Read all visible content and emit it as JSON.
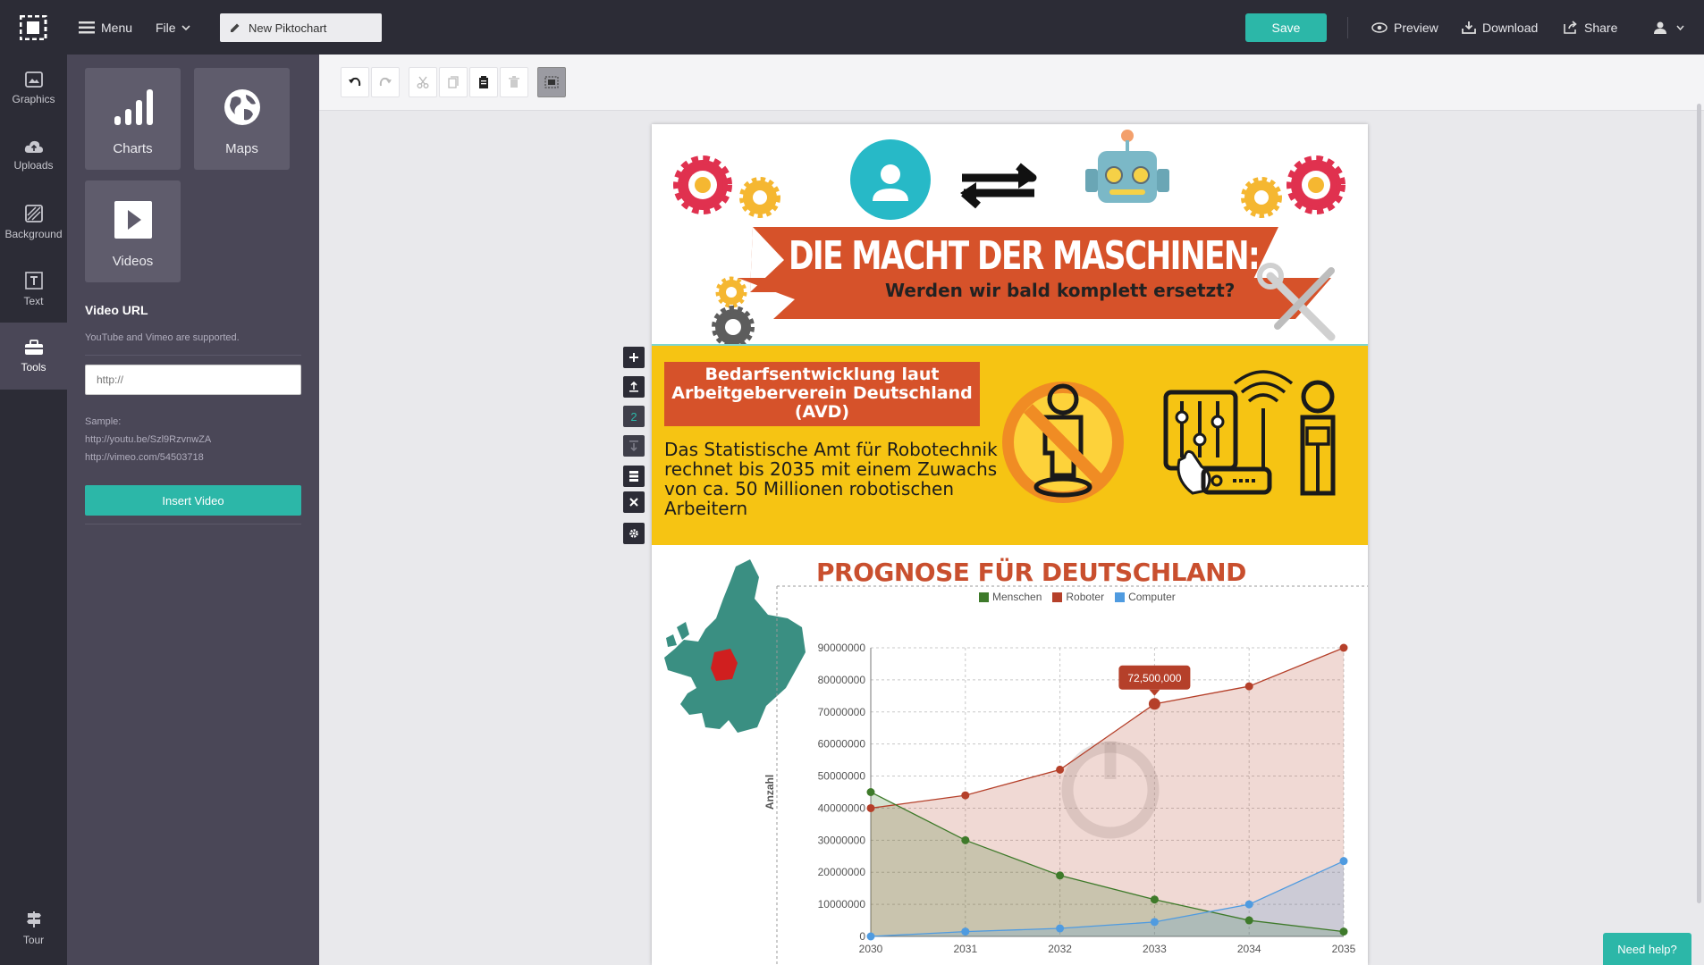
{
  "topbar": {
    "menu": "Menu",
    "file": "File",
    "title": "New Piktochart",
    "save": "Save",
    "preview": "Preview",
    "download": "Download",
    "share": "Share"
  },
  "iconbar": {
    "graphics": "Graphics",
    "uploads": "Uploads",
    "background": "Background",
    "text": "Text",
    "tools": "Tools",
    "tour": "Tour"
  },
  "panel": {
    "tiles": [
      "Charts",
      "Maps",
      "Videos"
    ],
    "video_url_label": "Video URL",
    "video_url_hint": "YouTube and Vimeo are supported.",
    "video_url_placeholder": "http://",
    "sample_label": "Sample:",
    "sample_1": "http://youtu.be/Szl9RzvnwZA",
    "sample_2": "http://vimeo.com/54503718",
    "insert_button": "Insert Video"
  },
  "side_tools": {
    "block_number": "2"
  },
  "infographic": {
    "banner_title": "DIE MACHT DER MASCHINEN:",
    "banner_subtitle": "Werden wir bald komplett ersetzt?",
    "box_title": "Bedarfsentwicklung laut Arbeitgeberverein Deutschland (AVD)",
    "box_text": "Das Statistische Amt für Robotechnik rechnet bis 2035 mit einem Zuwachs von ca. 50 Millionen robotischen Arbeitern",
    "chart_title": "PROGNOSE FÜR DEUTSCHLAND"
  },
  "chart_data": {
    "type": "area",
    "title": "PROGNOSE FÜR DEUTSCHLAND",
    "x": [
      2030,
      2031,
      2032,
      2033,
      2034,
      2035
    ],
    "ylabel": "Anzahl",
    "xlabel": "",
    "ylim": [
      0,
      90000000
    ],
    "yticks": [
      0,
      10000000,
      20000000,
      30000000,
      40000000,
      50000000,
      60000000,
      70000000,
      80000000,
      90000000
    ],
    "series": [
      {
        "name": "Menschen",
        "color": "#3e7a2a",
        "values": [
          45000000,
          30000000,
          19000000,
          11500000,
          5000000,
          1500000
        ]
      },
      {
        "name": "Roboter",
        "color": "#b5402a",
        "values": [
          40000000,
          44000000,
          52000000,
          72500000,
          78000000,
          90000000
        ]
      },
      {
        "name": "Computer",
        "color": "#4f9be0",
        "values": [
          0,
          1500000,
          2500000,
          4500000,
          10000000,
          23500000
        ]
      }
    ],
    "tooltip": {
      "series": "Roboter",
      "x": 2033,
      "label": "72,500,000"
    },
    "legend_position": "top",
    "grid": true
  },
  "help": {
    "label": "Need help?"
  },
  "colors": {
    "accent": "#2cb7a8",
    "dark": "#2c2c36",
    "panel": "#4a4757",
    "banner": "#d6522a",
    "yellow": "#f6c413"
  }
}
